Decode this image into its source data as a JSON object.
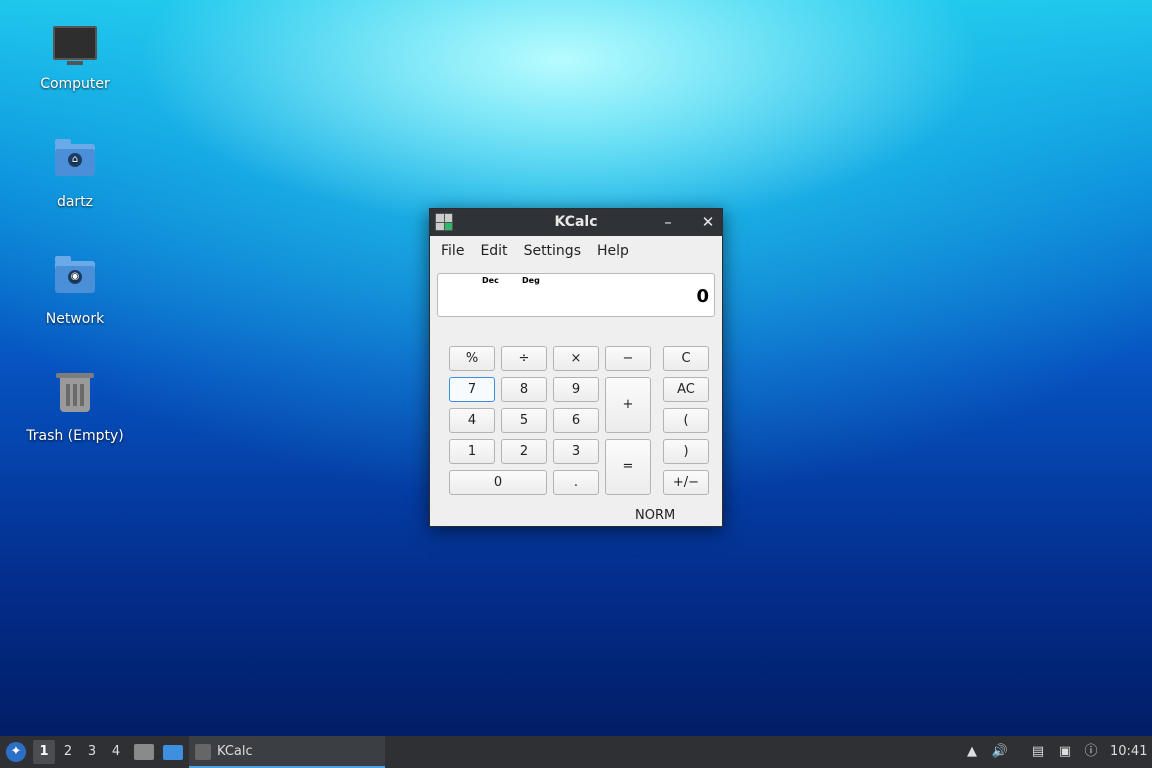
{
  "desktop": {
    "icons": [
      {
        "label": "Computer"
      },
      {
        "label": "dartz"
      },
      {
        "label": "Network"
      },
      {
        "label": "Trash (Empty)"
      }
    ]
  },
  "window": {
    "title": "KCalc",
    "minimize": "–",
    "close": "✕",
    "menu": [
      "File",
      "Edit",
      "Settings",
      "Help"
    ],
    "display": {
      "base": "Dec",
      "angle": "Deg",
      "value": "0"
    },
    "keys": {
      "percent": "%",
      "divide": "÷",
      "multiply": "×",
      "minus": "−",
      "clear": "C",
      "seven": "7",
      "eight": "8",
      "nine": "9",
      "plus": "+",
      "all_clear": "AC",
      "four": "4",
      "five": "5",
      "six": "6",
      "open_paren": "(",
      "one": "1",
      "two": "2",
      "three": "3",
      "equals": "=",
      "close_paren": ")",
      "zero": "0",
      "point": ".",
      "plus_minus": "+/−"
    },
    "status": "NORM"
  },
  "taskbar": {
    "workspaces": [
      "1",
      "2",
      "3",
      "4"
    ],
    "active_workspace": "1",
    "task_label": "KCalc",
    "clock": "10:41"
  }
}
